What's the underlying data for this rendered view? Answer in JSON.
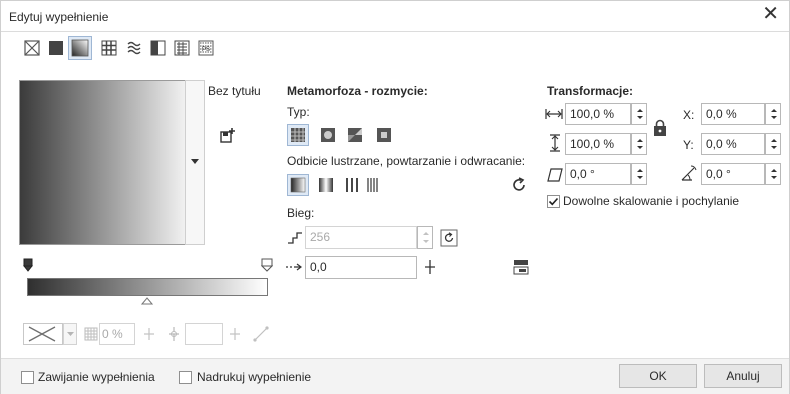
{
  "window": {
    "title": "Edytuj wypełnienie",
    "close_symbol": "✕"
  },
  "fill_types": [
    {
      "name": "no-fill-icon"
    },
    {
      "name": "uniform-fill-icon"
    },
    {
      "name": "fountain-fill-icon",
      "selected": true
    },
    {
      "name": "vector-pattern-fill-icon"
    },
    {
      "name": "bitmap-pattern-fill-icon"
    },
    {
      "name": "two-color-pattern-fill-icon"
    },
    {
      "name": "texture-fill-icon"
    },
    {
      "name": "postscript-fill-icon"
    }
  ],
  "preview": {
    "label": "Bez tytułu"
  },
  "morph": {
    "heading": "Metamorfoza - rozmycie:",
    "type_label": "Typ:",
    "mirror_label": "Odbicie lustrzane, powtarzanie i odwracanie:",
    "steps_label": "Bieg:",
    "steps_value": "256",
    "acceleration_value": "0,0"
  },
  "transform": {
    "heading": "Transformacje:",
    "width_value": "100,0 %",
    "height_value": "100,0 %",
    "skew_value": "0,0 °",
    "x_label": "X:",
    "x_value": "0,0 %",
    "y_label": "Y:",
    "y_value": "0,0 %",
    "rotate_value": "0,0 °",
    "free_scale_label": "Dowolne skalowanie i pochylanie",
    "free_scale_checked": true
  },
  "node_controls": {
    "opacity_value": "0 %"
  },
  "footer": {
    "wrap_label": "Zawijanie wypełnienia",
    "overprint_label": "Nadrukuj wypełnienie",
    "ok_label": "OK",
    "cancel_label": "Anuluj"
  }
}
